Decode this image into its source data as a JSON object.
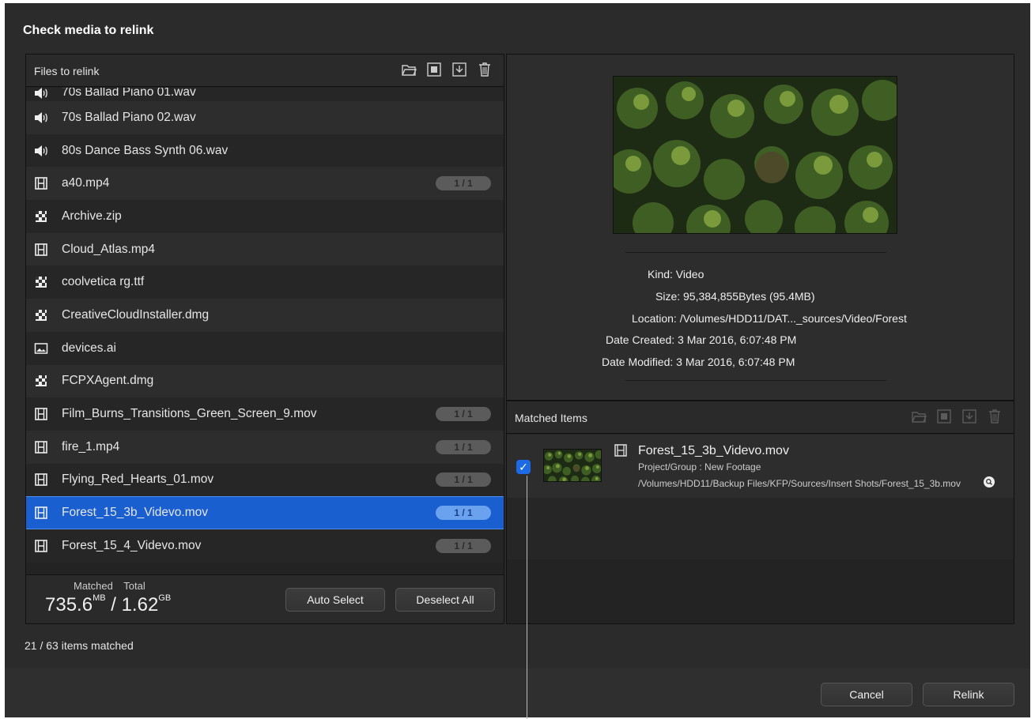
{
  "dialog": {
    "title": "Check media to relink"
  },
  "files_panel": {
    "header": "Files to relink",
    "header_icons": [
      "folder-icon",
      "frame-icon",
      "export-icon",
      "trash-icon"
    ],
    "files": [
      {
        "name": "70s Ballad Piano 01.wav",
        "icon": "audio-icon",
        "badge": ""
      },
      {
        "name": "70s Ballad Piano 02.wav",
        "icon": "audio-icon",
        "badge": ""
      },
      {
        "name": "80s Dance Bass Synth 06.wav",
        "icon": "audio-icon",
        "badge": ""
      },
      {
        "name": "a40.mp4",
        "icon": "film-icon",
        "badge": "1 / 1"
      },
      {
        "name": "Archive.zip",
        "icon": "archive-icon",
        "badge": ""
      },
      {
        "name": "Cloud_Atlas.mp4",
        "icon": "film-icon",
        "badge": ""
      },
      {
        "name": "coolvetica rg.ttf",
        "icon": "archive-icon",
        "badge": ""
      },
      {
        "name": "CreativeCloudInstaller.dmg",
        "icon": "archive-icon",
        "badge": ""
      },
      {
        "name": "devices.ai",
        "icon": "image-icon",
        "badge": ""
      },
      {
        "name": "FCPXAgent.dmg",
        "icon": "archive-icon",
        "badge": ""
      },
      {
        "name": "Film_Burns_Transitions_Green_Screen_9.mov",
        "icon": "film-icon",
        "badge": "1 / 1"
      },
      {
        "name": "fire_1.mp4",
        "icon": "film-icon",
        "badge": "1 / 1"
      },
      {
        "name": "Flying_Red_Hearts_01.mov",
        "icon": "film-icon",
        "badge": "1 / 1"
      },
      {
        "name": "Forest_15_3b_Videvo.mov",
        "icon": "film-icon",
        "badge": "1 / 1",
        "selected": true
      },
      {
        "name": "Forest_15_4_Videvo.mov",
        "icon": "film-icon",
        "badge": "1 / 1"
      }
    ],
    "footer": {
      "matched_label": "Matched",
      "total_label": "Total",
      "matched_value": "735.6",
      "matched_unit": "MB",
      "separator": " / ",
      "total_value": "1.62",
      "total_unit": "GB",
      "auto_select_label": "Auto Select",
      "deselect_all_label": "Deselect All"
    }
  },
  "preview": {
    "kind": "Kind: Video",
    "size": "Size: 95,384,855Bytes (95.4MB)",
    "location": "Location: /Volumes/HDD11/DAT..._sources/Video/Forest",
    "date_created": "Date Created: 3 Mar 2016, 6:07:48 PM",
    "date_modified": "Date Modified: 3 Mar 2016, 6:07:48 PM"
  },
  "matched_panel": {
    "header": "Matched Items",
    "item": {
      "checked": true,
      "name": "Forest_15_3b_Videvo.mov",
      "project": "Project/Group : New Footage",
      "path": "/Volumes/HDD11/Backup Files/KFP/Sources/Insert Shots/Forest_15_3b.mov"
    }
  },
  "status": {
    "text": "21 / 63 items matched"
  },
  "buttons": {
    "cancel": "Cancel",
    "relink": "Relink"
  },
  "colors": {
    "selection": "#1a5fd0",
    "background": "#2b2b2b",
    "checkbox": "#1d6ae5"
  }
}
